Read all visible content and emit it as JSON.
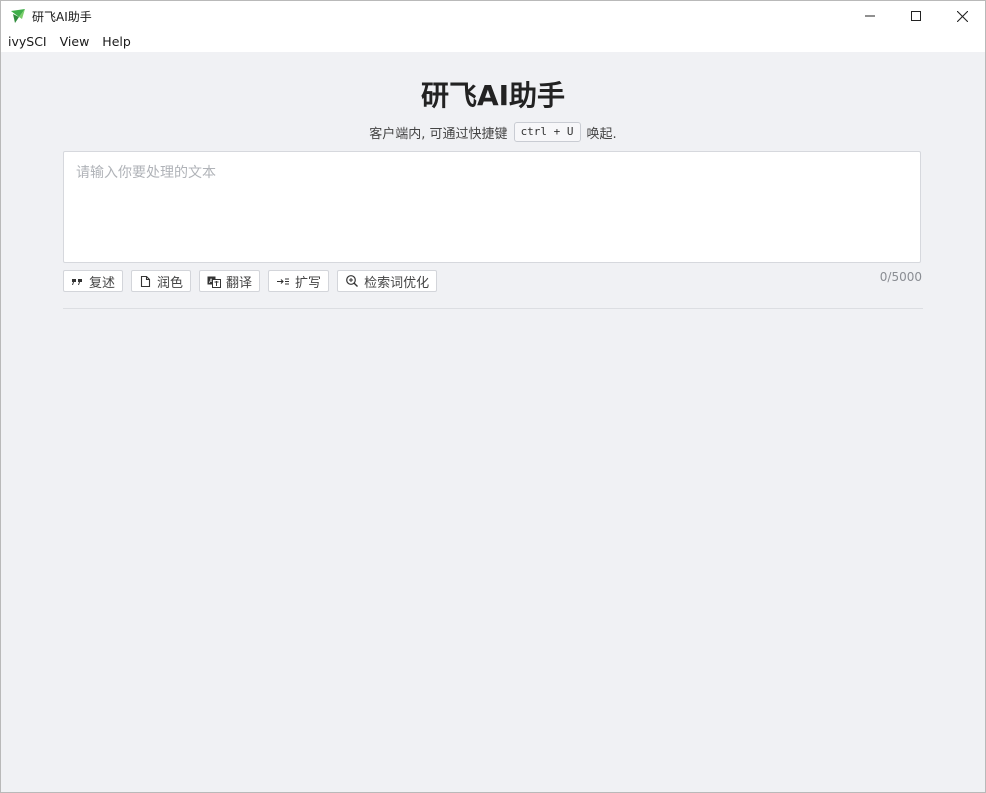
{
  "window": {
    "title": "研飞AI助手",
    "controls": [
      "minimize",
      "maximize",
      "close"
    ]
  },
  "menubar": {
    "items": [
      "ivySCI",
      "View",
      "Help"
    ]
  },
  "main": {
    "heading": "研飞AI助手",
    "hint_prefix": "客户端内, 可通过快捷键",
    "shortcut": "ctrl + U",
    "hint_suffix": "唤起.",
    "input": {
      "value": "",
      "placeholder": "请输入你要处理的文本"
    },
    "counter": "0/5000",
    "actions": [
      {
        "label": "复述",
        "icon": "quote-icon"
      },
      {
        "label": "润色",
        "icon": "document-icon"
      },
      {
        "label": "翻译",
        "icon": "translate-icon"
      },
      {
        "label": "扩写",
        "icon": "expand-icon"
      },
      {
        "label": "检索词优化",
        "icon": "search-optimize-icon"
      }
    ]
  },
  "colors": {
    "background": "#f0f1f4",
    "logo_green": "#3fae49"
  }
}
